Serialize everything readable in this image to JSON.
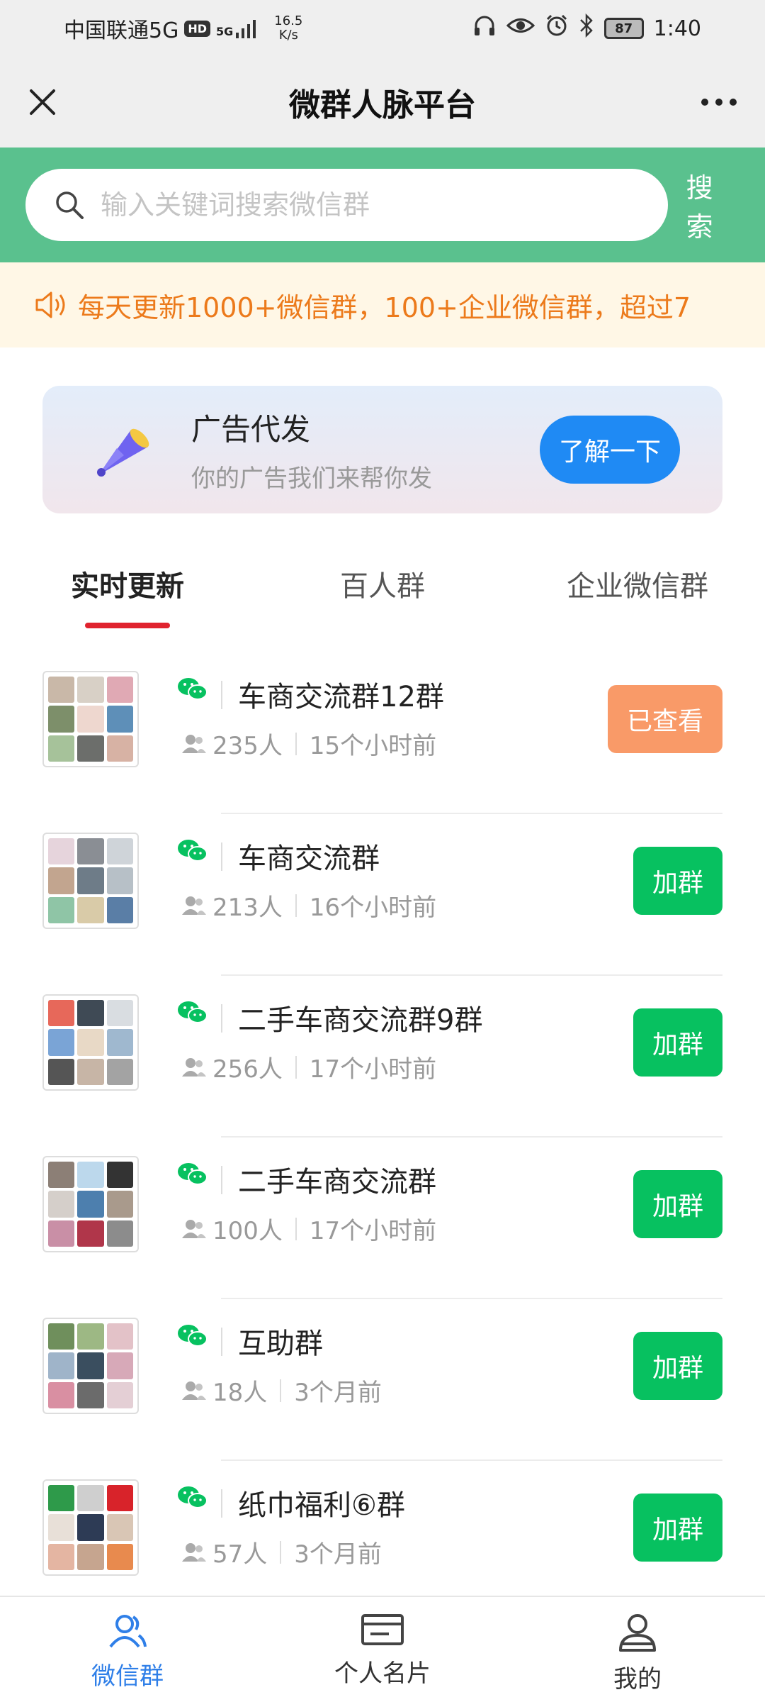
{
  "status_bar": {
    "carrier": "中国联通5G",
    "hd": "HD",
    "signal": "5G",
    "net_speed_value": "16.5",
    "net_speed_unit": "K/s",
    "battery": "87",
    "time": "1:40"
  },
  "header": {
    "title": "微群人脉平台"
  },
  "search": {
    "placeholder": "输入关键词搜索微信群",
    "button_label": "搜索"
  },
  "notice": {
    "text": "每天更新1000+微信群，100+企业微信群，超过7"
  },
  "ad": {
    "title": "广告代发",
    "subtitle": "你的广告我们来帮你发",
    "button_label": "了解一下"
  },
  "tabs": [
    {
      "label": "实时更新",
      "active": true
    },
    {
      "label": "百人群",
      "active": false
    },
    {
      "label": "企业微信群",
      "active": false
    }
  ],
  "groups": [
    {
      "name": "车商交流群12群",
      "members": "235人",
      "time": "15个小时前",
      "action": "已查看"
    },
    {
      "name": "车商交流群",
      "members": "213人",
      "time": "16个小时前",
      "action": "加群"
    },
    {
      "name": "二手车商交流群9群",
      "members": "256人",
      "time": "17个小时前",
      "action": "加群"
    },
    {
      "name": "二手车商交流群",
      "members": "100人",
      "time": "17个小时前",
      "action": "加群"
    },
    {
      "name": "互助群",
      "members": "18人",
      "time": "3个月前",
      "action": "加群"
    },
    {
      "name": "纸巾福利⑥群",
      "members": "57人",
      "time": "3个月前",
      "action": "加群"
    }
  ],
  "bottom_nav": [
    {
      "label": "微信群",
      "icon": "user-group-icon",
      "active": true
    },
    {
      "label": "个人名片",
      "icon": "card-icon",
      "active": false
    },
    {
      "label": "我的",
      "icon": "profile-icon",
      "active": false
    }
  ],
  "colors": {
    "search_band": "#5ac18e",
    "notice_text": "#ec7a1b",
    "ad_button": "#1f8af4",
    "tab_underline": "#e0232e",
    "join_button": "#07c160",
    "viewed_button": "#f99a68",
    "nav_active": "#2f7fe8"
  }
}
